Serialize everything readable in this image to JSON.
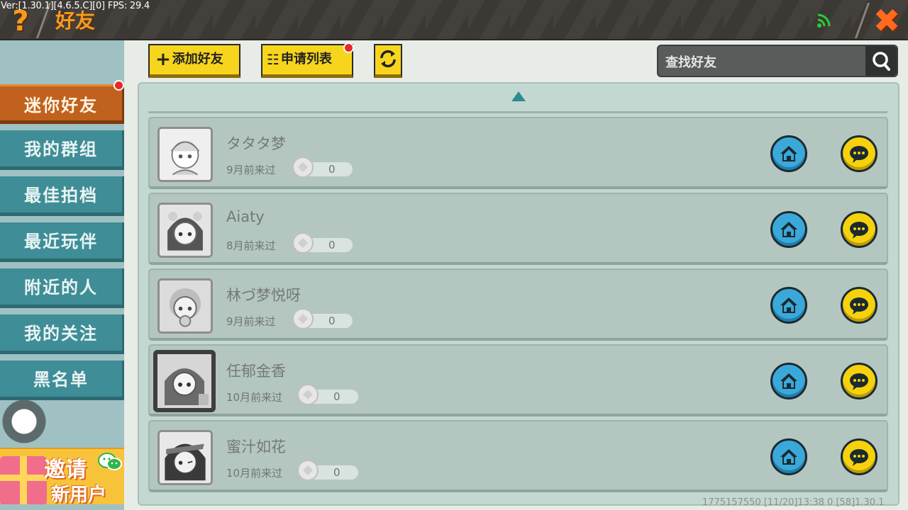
{
  "debug_overlay": "Ver:[1.30.1][4.6.5.C][0] FPS: 29.4",
  "header": {
    "title": "好友",
    "help_icon": "question-mark-icon",
    "close_icon": "close-x-icon",
    "signal_icon": "wifi-signal-icon"
  },
  "sidebar": {
    "tabs": [
      {
        "label": "迷你好友",
        "active": true,
        "badge": true
      },
      {
        "label": "我的群组"
      },
      {
        "label": "最佳拍档"
      },
      {
        "label": "最近玩伴"
      },
      {
        "label": "附近的人"
      },
      {
        "label": "我的关注"
      },
      {
        "label": "黑名单"
      }
    ],
    "invite": {
      "line1": "邀请",
      "line2": "新用户"
    }
  },
  "toolbar": {
    "add_friend_label": "添加好友",
    "request_list_label": "申请列表",
    "refresh_icon": "refresh-icon"
  },
  "search": {
    "placeholder": "查找好友",
    "icon": "search-icon"
  },
  "friends": [
    {
      "name": "タタタ梦",
      "last_seen": "9月前来过",
      "score": "0"
    },
    {
      "name": "Aiaty",
      "last_seen": "8月前来过",
      "score": "0"
    },
    {
      "name": "林づ梦悦呀",
      "last_seen": "9月前来过",
      "score": "0"
    },
    {
      "name": "任郁金香",
      "last_seen": "10月前来过",
      "score": "0"
    },
    {
      "name": "蜜汁如花",
      "last_seen": "10月前来过",
      "score": "0"
    }
  ],
  "footer_debug": "1775157550   [11/20]13:38 0   [58]1.30.1",
  "colors": {
    "active_tab": "#c0621d",
    "tab": "#3f8d96",
    "toolbar_button": "#f7d51d",
    "home_button": "#3aa9da",
    "chat_button": "#f5d20d",
    "badge": "#e82828"
  }
}
